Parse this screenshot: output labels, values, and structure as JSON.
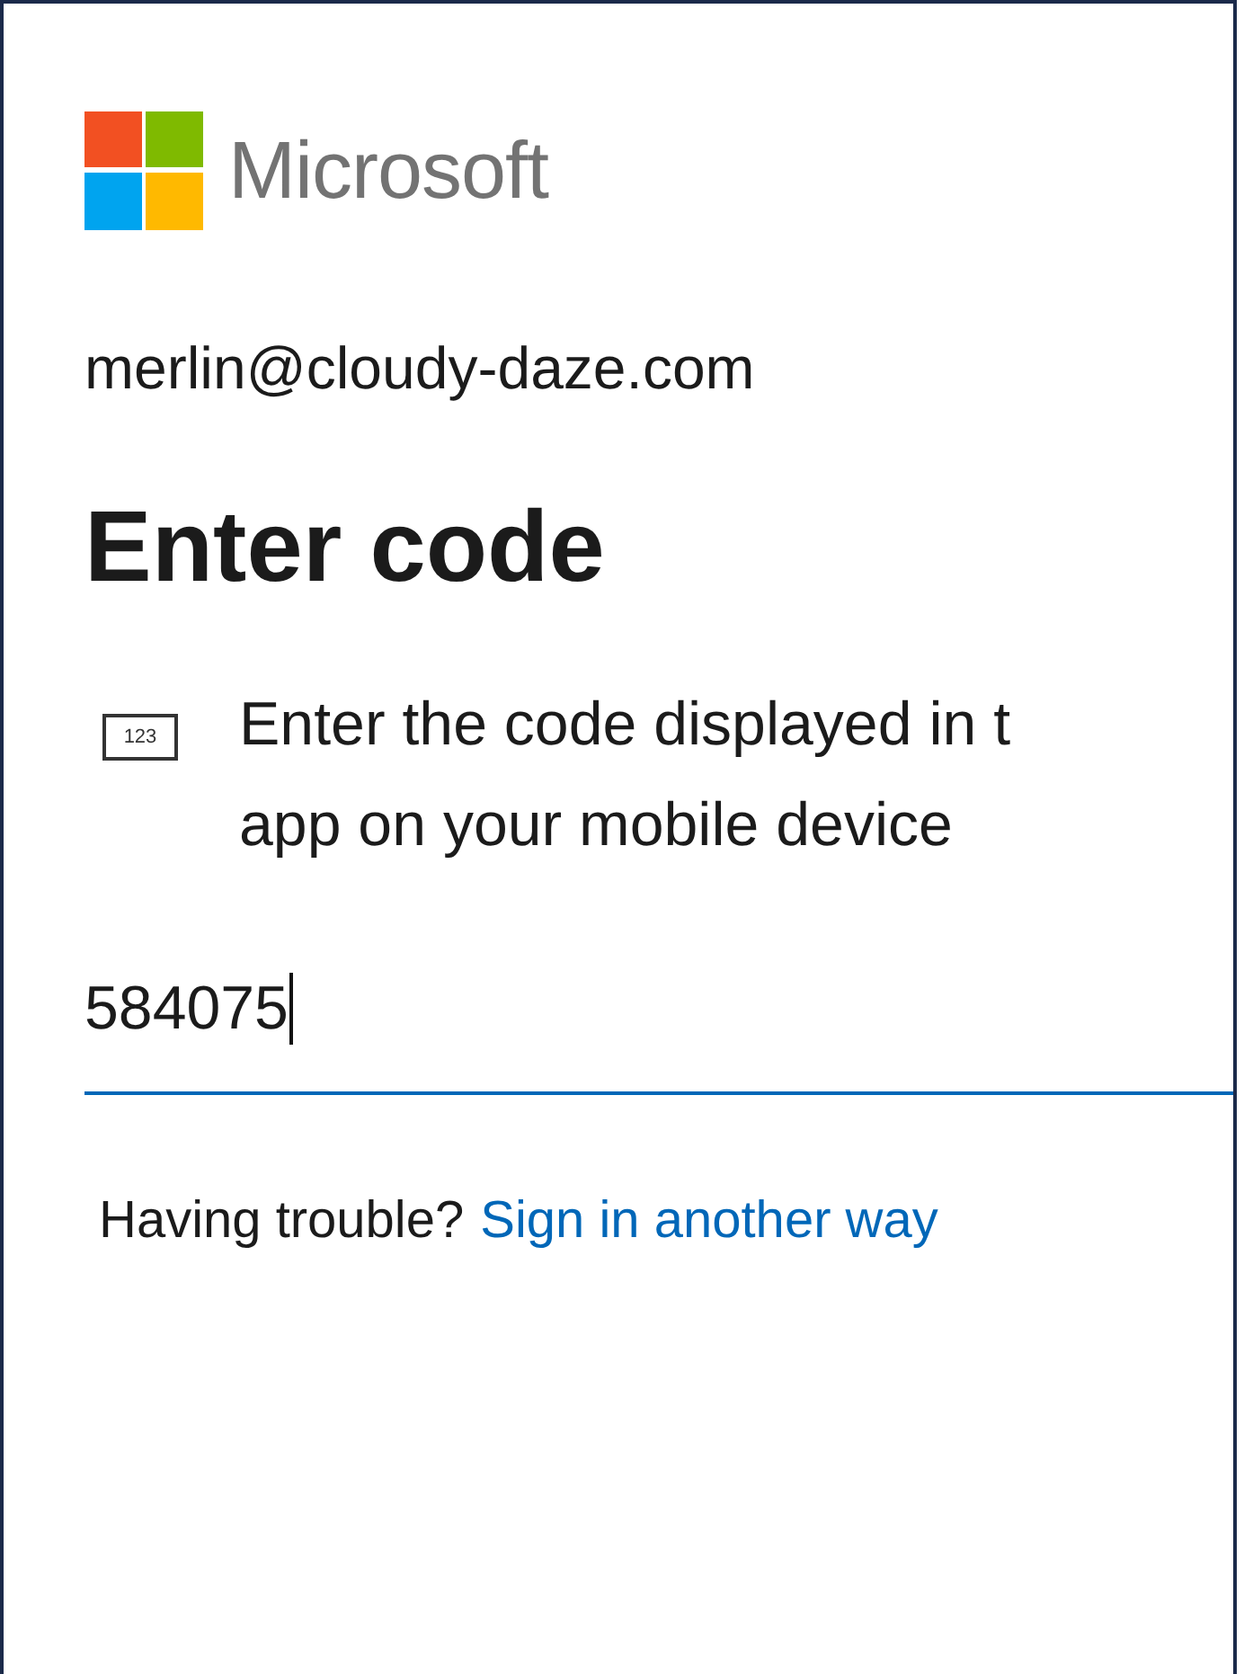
{
  "brand": {
    "name": "Microsoft"
  },
  "account": "merlin@cloudy-daze.com",
  "title": "Enter code",
  "instruction": {
    "icon_text": "123",
    "lines": [
      "Enter the code displayed in t",
      "app on your mobile device"
    ]
  },
  "code_field": {
    "value": "584075",
    "focused": true
  },
  "help": {
    "text": "Having trouble?",
    "link": "Sign in another way"
  }
}
